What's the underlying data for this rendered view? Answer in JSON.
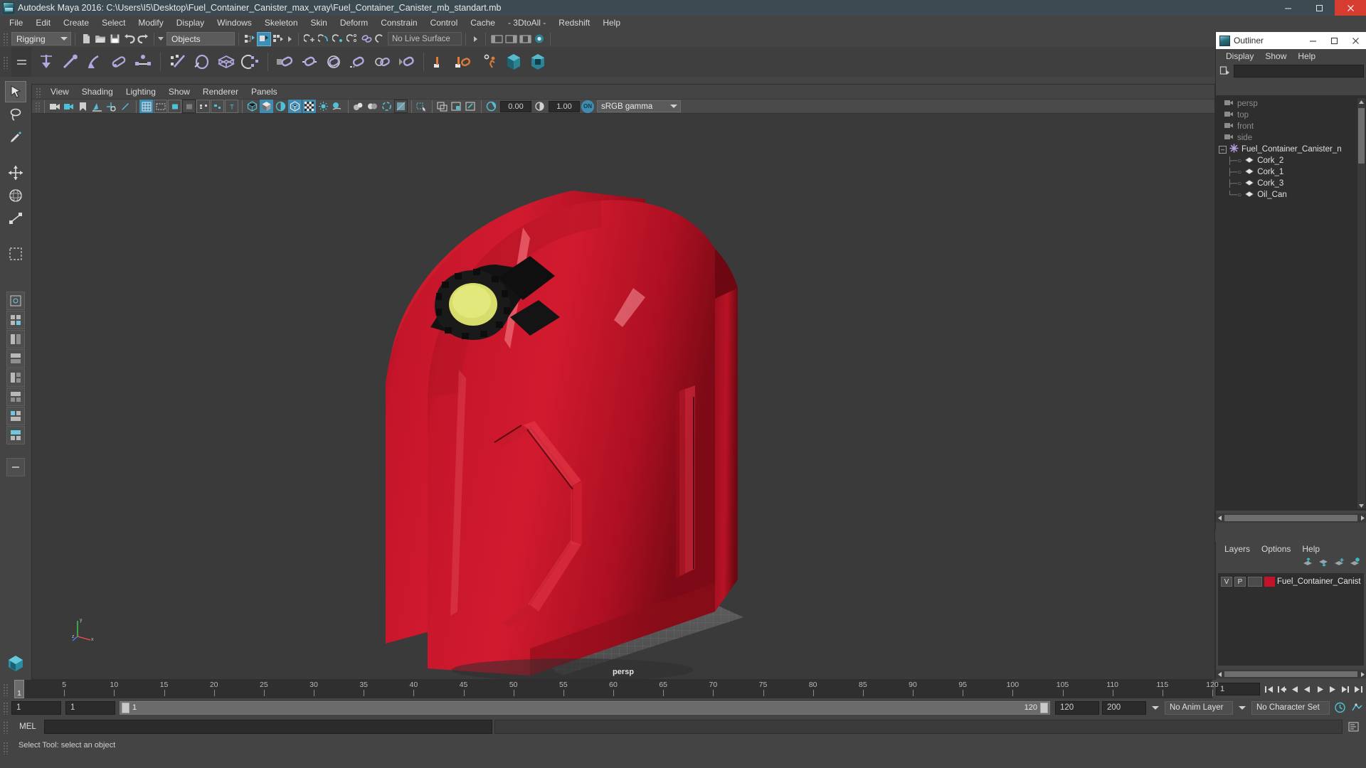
{
  "window": {
    "title": "Autodesk Maya 2016: C:\\Users\\I5\\Desktop\\Fuel_Container_Canister_max_vray\\Fuel_Container_Canister_mb_standart.mb",
    "app_icon": "maya-icon",
    "minimize_label": "–",
    "maximize_label": "❐",
    "close_label": "✕",
    "accent_close": "#d63c2f"
  },
  "menubar": {
    "items": [
      {
        "label": "File"
      },
      {
        "label": "Edit"
      },
      {
        "label": "Create"
      },
      {
        "label": "Select"
      },
      {
        "label": "Modify"
      },
      {
        "label": "Display"
      },
      {
        "label": "Windows"
      },
      {
        "label": "Skeleton"
      },
      {
        "label": "Skin"
      },
      {
        "label": "Deform"
      },
      {
        "label": "Constrain"
      },
      {
        "label": "Control"
      },
      {
        "label": "Cache"
      },
      {
        "label": "- 3DtoAll -"
      },
      {
        "label": "Redshift"
      },
      {
        "label": "Help"
      }
    ]
  },
  "statusline": {
    "menu_set": "Rigging",
    "object_mode": "Objects",
    "live_surface": "No Live Surface",
    "icons": [
      "new-scene-icon",
      "open-scene-icon",
      "save-scene-icon",
      "undo-icon",
      "redo-icon",
      "select-hierarchy-icon",
      "select-object-icon",
      "select-component-icon",
      "snap-grid-icon",
      "snap-curve-icon",
      "snap-point-icon",
      "snap-projected-center-icon",
      "snap-view-plane-icon",
      "make-live-icon",
      "show-hide-editors-icon",
      "attribute-editor-icon",
      "tool-settings-icon",
      "channel-box-icon",
      "render-view-icon"
    ]
  },
  "shelf": {
    "tab_icon": "shelf-menu-icon",
    "items": [
      "joint-tool-icon",
      "ik-handle-icon",
      "ik-spline-icon",
      "ik-chain-icon",
      "constraint-icon",
      "skin-bind-icon",
      "interactive-bind-icon",
      "lattice-icon",
      "cluster-icon",
      "parent-constraint-icon",
      "point-constraint-icon",
      "orient-constraint-icon",
      "scale-constraint-icon",
      "aim-constraint-icon",
      "pole-vector-icon",
      "set-driven-key-icon",
      "character-set-icon",
      "pose-icon",
      "redshift-render-icon",
      "redshift-ipr-icon"
    ]
  },
  "toolbox": {
    "tools": [
      {
        "name": "select-tool",
        "active": true
      },
      {
        "name": "lasso-tool",
        "active": false
      },
      {
        "name": "paint-select-tool",
        "active": false
      },
      {
        "name": "move-tool",
        "active": false
      },
      {
        "name": "rotate-tool",
        "active": false
      },
      {
        "name": "scale-tool",
        "active": false
      },
      {
        "name": "last-tool",
        "active": false
      }
    ],
    "layouts": [
      "single-perspective-layout",
      "four-view-layout",
      "two-pane-side-layout",
      "two-pane-stacked-layout",
      "three-pane-layout",
      "three-pane-alt-layout",
      "hypergraph-layout",
      "outliner-layout",
      "more-layouts"
    ]
  },
  "viewport": {
    "menus": [
      {
        "label": "View"
      },
      {
        "label": "Shading"
      },
      {
        "label": "Lighting"
      },
      {
        "label": "Show"
      },
      {
        "label": "Renderer"
      },
      {
        "label": "Panels"
      }
    ],
    "toolbar_icons": [
      "select-camera-icon",
      "camera-attributes-icon",
      "bookmark-icon",
      "image-plane-icon",
      "2d-pan-zoom-icon",
      "grease-pencil-icon",
      "grid-toggle-icon",
      "film-gate-icon",
      "resolution-gate-icon",
      "gate-mask-icon",
      "film-origin-icon",
      "safe-action-icon",
      "title-safe-icon",
      "wireframe-shading-icon",
      "smooth-shading-icon",
      "shaded-wireframe-icon",
      "textured-shading-icon",
      "use-all-lights-icon",
      "shadows-icon",
      "screen-space-ao-icon",
      "motion-blur-icon",
      "multisample-icon",
      "depth-of-field-icon",
      "isolate-select-icon",
      "xray-icon",
      "xray-joints-icon",
      "xray-active-components-icon",
      "exposure-icon",
      "gamma-icon",
      "color-management-toggle-icon"
    ],
    "exposure_value": "0.00",
    "gamma_value": "1.00",
    "cm_toggle_label": "ON",
    "color_profile": "sRGB gamma",
    "camera_label": "persp",
    "axis_labels": {
      "x": "x",
      "y": "y",
      "z": "z"
    },
    "bg_color": "#3a3a3a",
    "model_color": "#c4172a"
  },
  "outliner": {
    "title": "Outliner",
    "window_buttons": {
      "minimize": "–",
      "maximize": "☐",
      "close": "✕"
    },
    "menus": [
      {
        "label": "Display"
      },
      {
        "label": "Show"
      },
      {
        "label": "Help"
      }
    ],
    "search_value": "",
    "search_placeholder": "",
    "filter_icon": "outliner-filter-icon",
    "items": [
      {
        "label": "persp",
        "icon": "camera-icon",
        "type": "camera",
        "indent": 1
      },
      {
        "label": "top",
        "icon": "camera-icon",
        "type": "camera",
        "indent": 1
      },
      {
        "label": "front",
        "icon": "camera-icon",
        "type": "camera",
        "indent": 1
      },
      {
        "label": "side",
        "icon": "camera-icon",
        "type": "camera",
        "indent": 1
      },
      {
        "label": "Fuel_Container_Canister_n",
        "icon": "group-icon",
        "type": "group",
        "indent": 0,
        "expanded": true
      },
      {
        "label": "Cork_2",
        "icon": "mesh-icon",
        "type": "mesh",
        "indent": 2
      },
      {
        "label": "Cork_1",
        "icon": "mesh-icon",
        "type": "mesh",
        "indent": 2
      },
      {
        "label": "Cork_3",
        "icon": "mesh-icon",
        "type": "mesh",
        "indent": 2
      },
      {
        "label": "Oil_Can",
        "icon": "mesh-icon",
        "type": "mesh",
        "indent": 2
      }
    ]
  },
  "layers": {
    "menus": [
      {
        "label": "Layers"
      },
      {
        "label": "Options"
      },
      {
        "label": "Help"
      }
    ],
    "buttons": [
      "move-layer-up-icon",
      "move-layer-down-icon",
      "new-layer-icon",
      "new-layer-from-selected-icon"
    ],
    "rows": [
      {
        "visibility": "V",
        "playback": "P",
        "shading": "",
        "color": "#c3122a",
        "name": "Fuel_Container_Canist"
      }
    ]
  },
  "timeline": {
    "start_frame": "1",
    "end_frame": "120",
    "current_frame": "1",
    "range_start": "1",
    "range_end": "120",
    "playback_start": "1",
    "playback_end": "120",
    "anim_end": "200",
    "tick_labels": [
      "5",
      "10",
      "15",
      "20",
      "25",
      "30",
      "35",
      "40",
      "45",
      "50",
      "55",
      "60",
      "65",
      "70",
      "75",
      "80",
      "85",
      "90",
      "95",
      "100",
      "105",
      "110",
      "115",
      "120"
    ],
    "current_frame_field": "1",
    "anim_layer": "No Anim Layer",
    "character_set": "No Character Set",
    "playback_buttons": [
      "go-to-start-icon",
      "step-back-key-icon",
      "step-back-frame-icon",
      "play-backwards-icon",
      "play-forwards-icon",
      "step-forward-frame-icon",
      "step-forward-key-icon",
      "go-to-end-icon"
    ],
    "auto_key_icon": "auto-key-icon",
    "anim_prefs_icon": "animation-preferences-icon"
  },
  "commandline": {
    "language_label": "MEL",
    "input_value": "",
    "output_value": "",
    "script_editor_icon": "script-editor-icon"
  },
  "helpline": {
    "text": "Select Tool: select an object"
  }
}
